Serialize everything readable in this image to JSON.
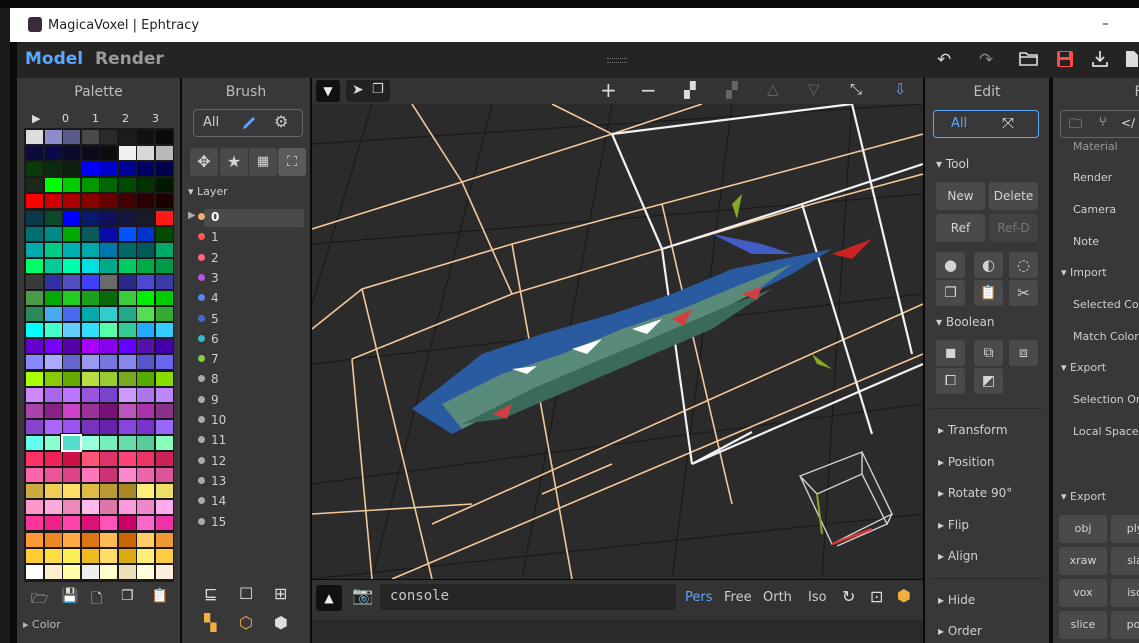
{
  "window": {
    "title": "MagicaVoxel | Ephtracy",
    "minimize": "–"
  },
  "menubar": {
    "model": "Model",
    "render": "Render"
  },
  "top_toolbar": {
    "icons": [
      "undo-icon",
      "redo-icon",
      "open-icon",
      "save-icon",
      "export-icon",
      "file-icon"
    ],
    "save_color": "#ff4a4a"
  },
  "palette": {
    "title": "Palette",
    "tabs": [
      "▶",
      "0",
      "1",
      "2",
      "3"
    ],
    "colors": [
      [
        "#dcdcdc",
        "#8c8ccf",
        "#5a5a8c",
        "#4a4a4a",
        "#2a2a2a",
        "#1c1c1c",
        "#111111",
        "#0a0a0a"
      ],
      [
        "#0c0c3c",
        "#0a0a4a",
        "#0a0a2a",
        "#0b0b1a",
        "#0d0d0d",
        "#f0f0f0",
        "#d8d8d8",
        "#b8b8b8"
      ],
      [
        "#0a3a0a",
        "#0c2a0c",
        "#0e1e0e",
        "#0000ff",
        "#0000cc",
        "#000099",
        "#000066",
        "#00004a"
      ],
      [
        "#1a2a1a",
        "#00ff00",
        "#00cc00",
        "#009900",
        "#006600",
        "#004a00",
        "#003300",
        "#001a00"
      ],
      [
        "#ff0000",
        "#cc0000",
        "#aa0000",
        "#880000",
        "#660000",
        "#440000",
        "#2a0000",
        "#1a0000"
      ],
      [
        "#0a3a4a",
        "#0a4a2a",
        "#0000ff",
        "#0a1a6a",
        "#10105a",
        "#151540",
        "#1a1a2a",
        "#ff1a1a"
      ],
      [
        "#007070",
        "#008a8a",
        "#00aa00",
        "#0a5a5a",
        "#0a0aaa",
        "#0055ff",
        "#0033cc",
        "#004a00"
      ],
      [
        "#00aaaa",
        "#00cc88",
        "#00b0b0",
        "#00aaaa",
        "#0077aa",
        "#006a6a",
        "#005a5a",
        "#00aa66"
      ],
      [
        "#00ff66",
        "#00cc99",
        "#00ffaa",
        "#00e0e0",
        "#00aa88",
        "#00cc66",
        "#00aa44",
        "#009944"
      ],
      [
        "#3a3a3a",
        "#3030a0",
        "#5050c0",
        "#4040ff",
        "#6a6a6a",
        "#2a2a8a",
        "#4a4ad0",
        "#3a3aaa"
      ],
      [
        "#4a9a4a",
        "#00aa00",
        "#22cc22",
        "#1aa01a",
        "#0a6a0a",
        "#3acc3a",
        "#00ee00",
        "#00cc00"
      ],
      [
        "#2a8a5a",
        "#4aaaee",
        "#4a6aee",
        "#00aaaa",
        "#33cccc",
        "#22aa88",
        "#55dd55",
        "#33aa33"
      ],
      [
        "#00ffff",
        "#44ffcc",
        "#66ccff",
        "#33ddff",
        "#55ffaa",
        "#33cc99",
        "#22aaff",
        "#33ccff"
      ],
      [
        "#6600cc",
        "#7700ff",
        "#5500aa",
        "#aa00ff",
        "#8800ee",
        "#6600ff",
        "#5511aa",
        "#4400aa"
      ],
      [
        "#8888ff",
        "#aaaaff",
        "#6666cc",
        "#9999ee",
        "#7777dd",
        "#8888ee",
        "#5555cc",
        "#6666ee"
      ],
      [
        "#aaff00",
        "#88cc00",
        "#66aa00",
        "#bbdd44",
        "#99cc33",
        "#77aa22",
        "#55aa00",
        "#88dd00"
      ],
      [
        "#cc88ff",
        "#aa66ee",
        "#bb77ff",
        "#9955dd",
        "#7744cc",
        "#cc99ff",
        "#aa77ee",
        "#bb88ff"
      ],
      [
        "#aa44aa",
        "#882288",
        "#cc44cc",
        "#993399",
        "#771177",
        "#bb55bb",
        "#aa33aa",
        "#883388"
      ],
      [
        "#8844cc",
        "#aa66ff",
        "#9955ee",
        "#7733bb",
        "#6622aa",
        "#8844dd",
        "#7733cc",
        "#9966ff"
      ],
      [
        "#66ffee",
        "#88ffcc",
        "#55ddcc",
        "#99ffdd",
        "#77eebb",
        "#66ddaa",
        "#55cc99",
        "#88ffbb"
      ],
      [
        "#ff3366",
        "#ee2255",
        "#cc1144",
        "#ff5577",
        "#dd3366",
        "#ff4477",
        "#ee3366",
        "#cc2255"
      ],
      [
        "#ff66aa",
        "#ee5599",
        "#dd4488",
        "#ff77bb",
        "#cc3377",
        "#ff88cc",
        "#ee66aa",
        "#dd5599"
      ],
      [
        "#ccaa44",
        "#eecc55",
        "#ffdd66",
        "#ddbb44",
        "#bb9933",
        "#aa8822",
        "#ffee77",
        "#eedd66"
      ],
      [
        "#ff99cc",
        "#ffaadd",
        "#ee88bb",
        "#ffbbee",
        "#dd77aa",
        "#ff99dd",
        "#ee88cc",
        "#ffaaee"
      ],
      [
        "#ff3399",
        "#ee2288",
        "#ff44aa",
        "#dd1177",
        "#ff55bb",
        "#cc0066",
        "#ff66cc",
        "#ee33aa"
      ],
      [
        "#ff9933",
        "#ee8822",
        "#ffaa44",
        "#dd7711",
        "#ffbb55",
        "#cc6600",
        "#ffcc66",
        "#ee9933"
      ],
      [
        "#ffcc33",
        "#ffdd44",
        "#ffee55",
        "#eebb22",
        "#ffdd66",
        "#ddaa11",
        "#ffee77",
        "#ffcc44"
      ],
      [
        "#ffffff",
        "#ffeecc",
        "#ffffaa",
        "#eeeeee",
        "#ffffcc",
        "#eeddbb",
        "#ffffdd",
        "#ffeedd"
      ]
    ],
    "selected_row": 19,
    "selected_col": 2,
    "bottom_icons": [
      "folder-icon",
      "save-icon",
      "new-file-icon",
      "copy-icon",
      "paste-icon"
    ],
    "color_label": "Color"
  },
  "brush": {
    "title": "Brush",
    "all": "All",
    "layer_label": "Layer",
    "layers": [
      {
        "n": "0",
        "c": "#f0b070"
      },
      {
        "n": "1",
        "c": "#ff5555"
      },
      {
        "n": "2",
        "c": "#ff6688"
      },
      {
        "n": "3",
        "c": "#bb55dd"
      },
      {
        "n": "4",
        "c": "#5588ee"
      },
      {
        "n": "5",
        "c": "#4466dd"
      },
      {
        "n": "6",
        "c": "#33bbcc"
      },
      {
        "n": "7",
        "c": "#88cc44"
      },
      {
        "n": "8",
        "c": "#aaaaaa"
      },
      {
        "n": "9",
        "c": "#aaaaaa"
      },
      {
        "n": "10",
        "c": "#aaaaaa"
      },
      {
        "n": "11",
        "c": "#aaaaaa"
      },
      {
        "n": "12",
        "c": "#aaaaaa"
      },
      {
        "n": "13",
        "c": "#aaaaaa"
      },
      {
        "n": "14",
        "c": "#aaaaaa"
      },
      {
        "n": "15",
        "c": "#aaaaaa"
      }
    ]
  },
  "viewport": {
    "console": "console",
    "modes": [
      "Pers",
      "Free",
      "Orth",
      "Iso"
    ],
    "active_mode": "Pers"
  },
  "edit": {
    "title": "Edit",
    "all": "All",
    "tool": "Tool",
    "new": "New",
    "delete": "Delete",
    "ref": "Ref",
    "refd": "Ref-D",
    "boolean": "Boolean",
    "transform": "Transform",
    "position": "Position",
    "rotate": "Rotate 90°",
    "flip": "Flip",
    "align": "Align",
    "hide": "Hide",
    "order": "Order"
  },
  "file": {
    "title": "Fi",
    "items_top": [
      "Material",
      "Render",
      "Camera",
      "Note"
    ],
    "import": "Import",
    "import_items": [
      "Selected Colo",
      "Match Color"
    ],
    "export1": "Export",
    "export1_items": [
      "Selection On",
      "Local Space"
    ],
    "export2": "Export",
    "buttons": [
      [
        "obj",
        "ply"
      ],
      [
        "xraw",
        "sla"
      ],
      [
        "vox",
        "iso"
      ],
      [
        "slice",
        "poi"
      ]
    ]
  }
}
